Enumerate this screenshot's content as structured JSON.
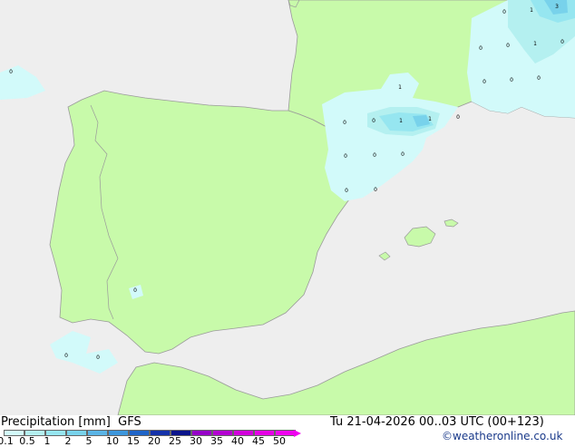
{
  "footer": {
    "title": "Precipitation [mm]",
    "model": "GFS",
    "datetime": "Tu 21-04-2026 00..03 UTC (00+123)",
    "credit": "©weatheronline.co.uk"
  },
  "legend": {
    "ticks": [
      "0.1",
      "0.5",
      "1",
      "2",
      "5",
      "10",
      "15",
      "20",
      "25",
      "30",
      "35",
      "40",
      "45",
      "50"
    ],
    "colors": [
      "#d2fafa",
      "#b4f0f0",
      "#96e6f0",
      "#78d2eb",
      "#5ab4e6",
      "#3c96dc",
      "#1e64c8",
      "#1432aa",
      "#0a148c",
      "#9600c8",
      "#b400d2",
      "#d200dc",
      "#e600e6",
      "#f000f0"
    ]
  },
  "colors": {
    "land": "#c8fa aa",
    "sea": "#eeeeee",
    "coast": "#999999"
  },
  "map_labels": [
    {
      "text": "0"
    },
    {
      "text": "1"
    },
    {
      "text": "3"
    },
    {
      "text": "0"
    },
    {
      "text": "1"
    },
    {
      "text": "0"
    },
    {
      "text": "0"
    },
    {
      "text": "0"
    },
    {
      "text": "0"
    },
    {
      "text": "0"
    },
    {
      "text": "1"
    },
    {
      "text": "0"
    },
    {
      "text": "0"
    },
    {
      "text": "1"
    },
    {
      "text": "1"
    },
    {
      "text": "0"
    },
    {
      "text": "0"
    },
    {
      "text": "0"
    },
    {
      "text": "0"
    },
    {
      "text": "0"
    },
    {
      "text": "0"
    },
    {
      "text": "0"
    },
    {
      "text": "0"
    },
    {
      "text": "0"
    },
    {
      "text": "0"
    }
  ]
}
